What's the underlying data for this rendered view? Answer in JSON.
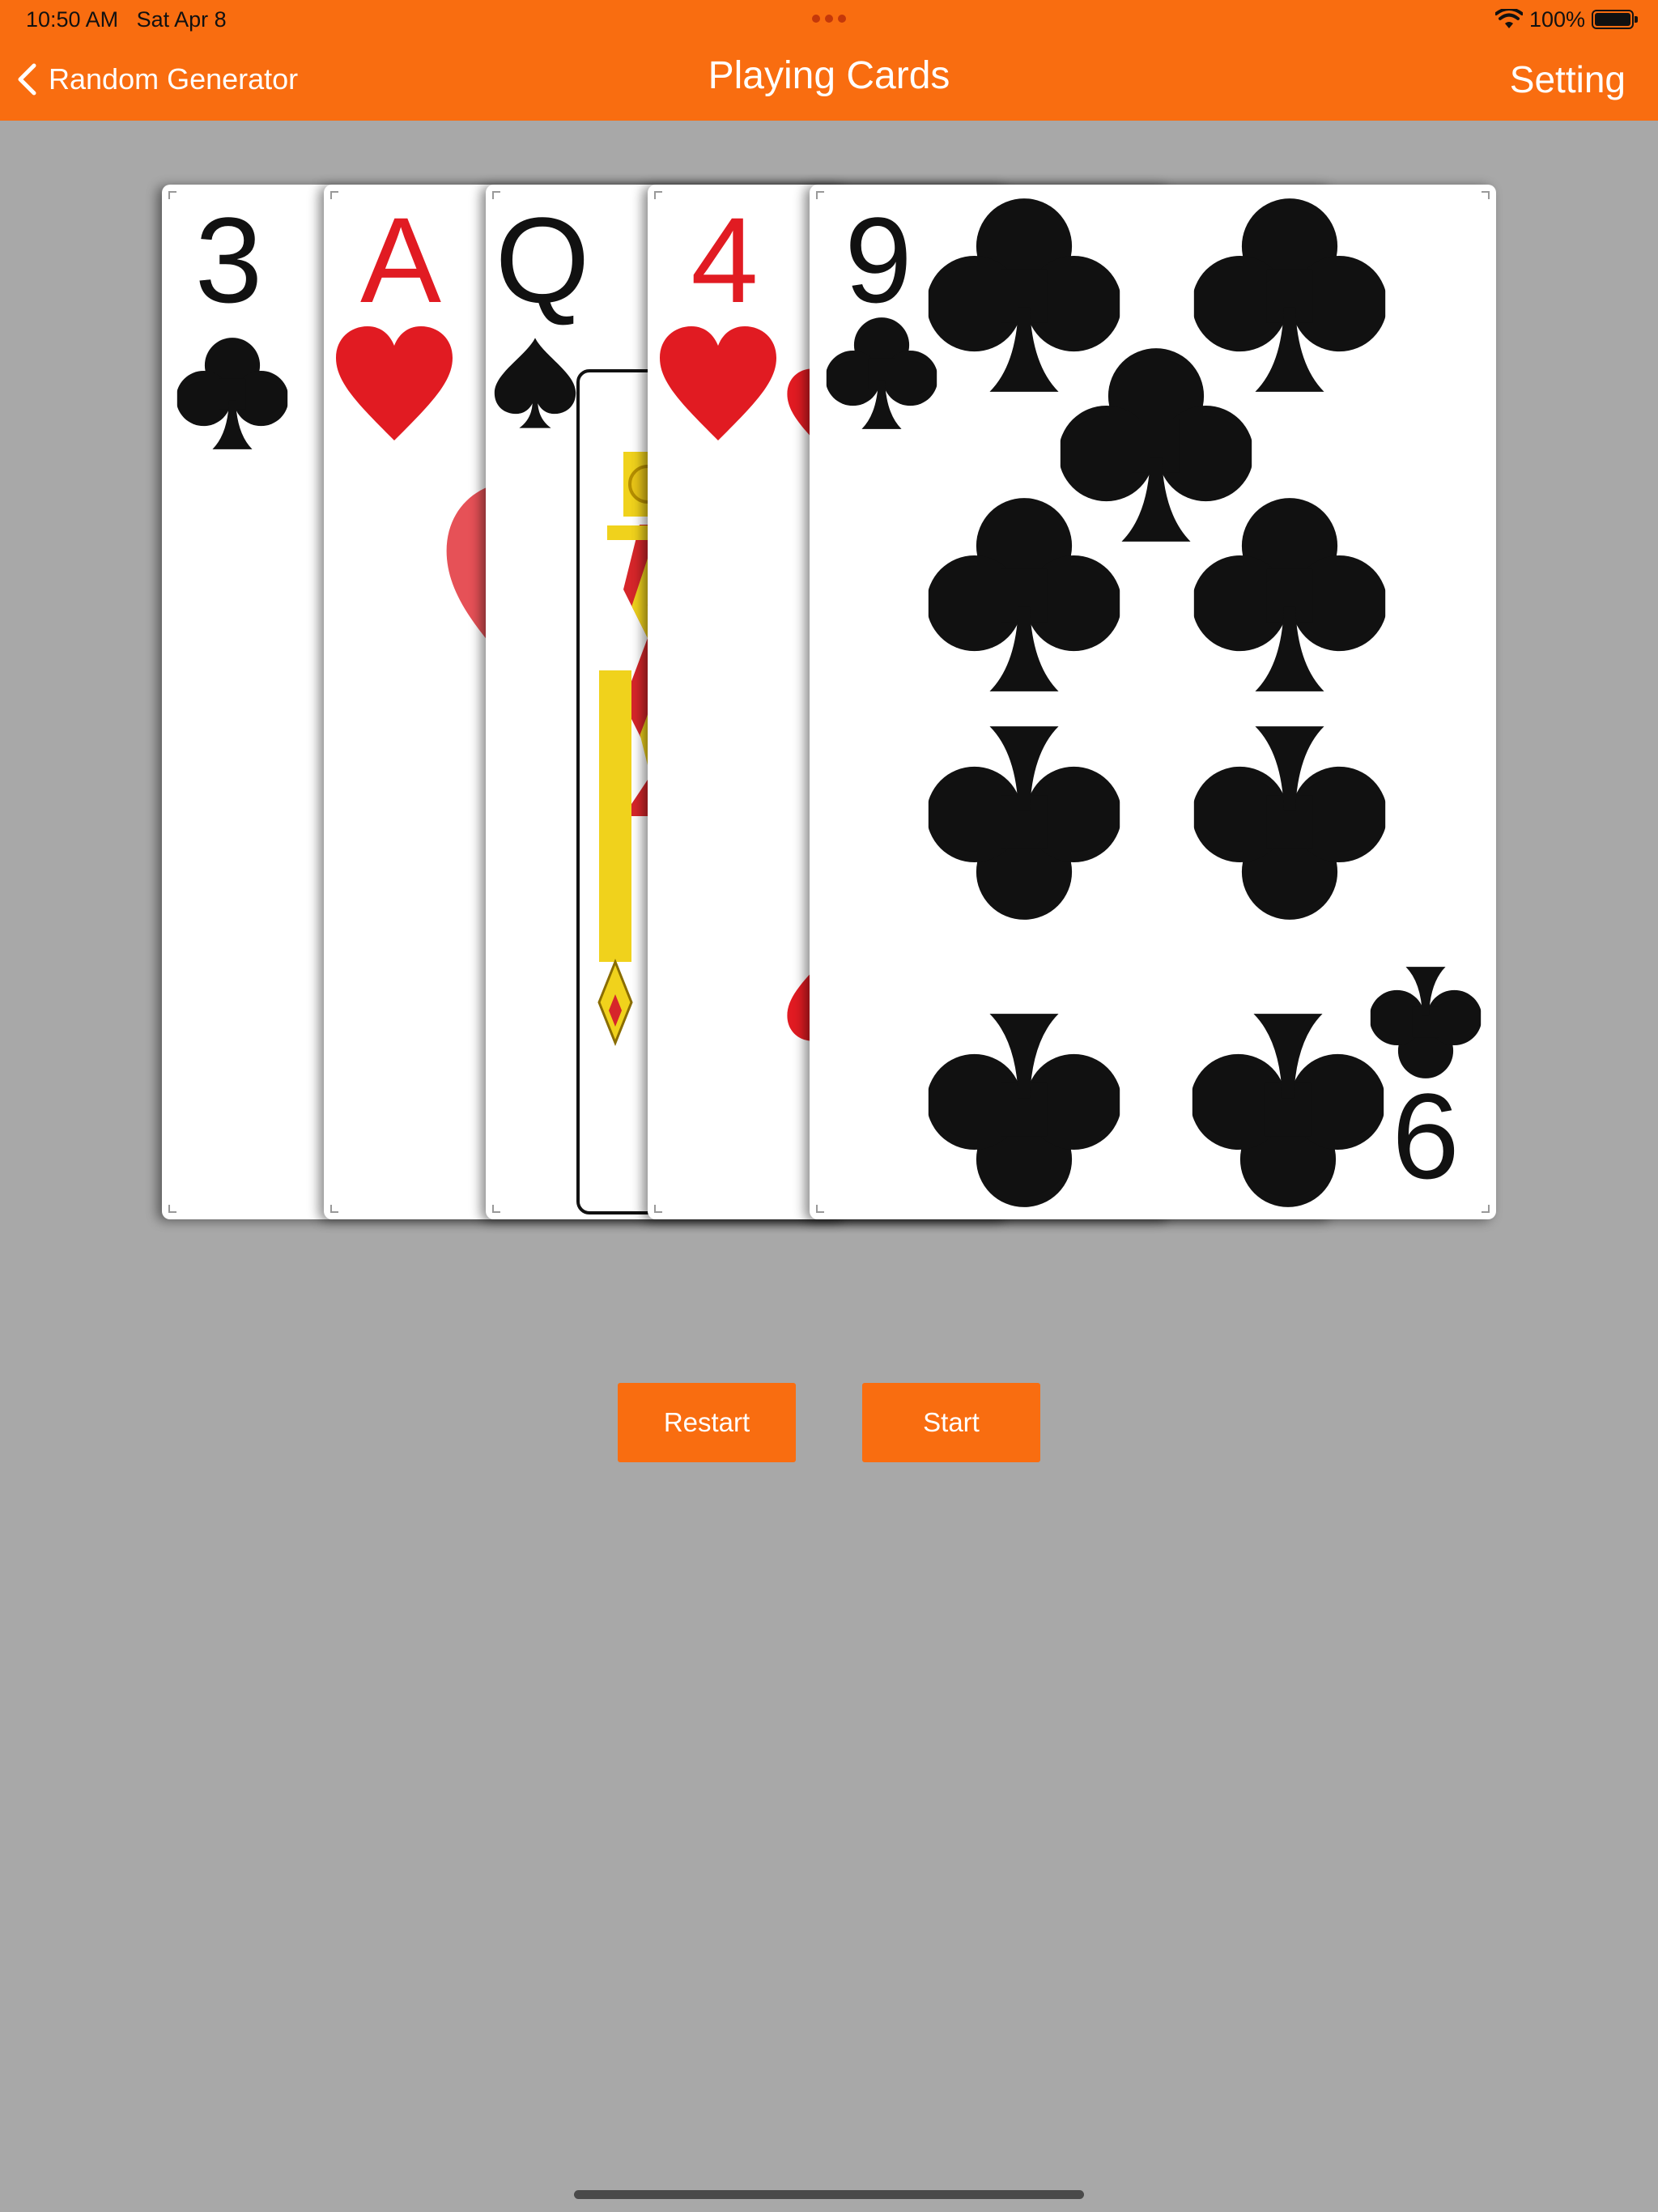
{
  "status_bar": {
    "time": "10:50 AM   Sat Apr 8",
    "battery": "100%"
  },
  "nav_bar": {
    "back_label": "Random Generator",
    "title": "Playing Cards",
    "right_label": "Setting"
  },
  "cards": [
    {
      "rank": "3",
      "suit": "clubs",
      "color": "black"
    },
    {
      "rank": "A",
      "suit": "hearts",
      "color": "red"
    },
    {
      "rank": "Q",
      "suit": "spades",
      "color": "black"
    },
    {
      "rank": "4",
      "suit": "hearts",
      "color": "red"
    },
    {
      "rank": "9",
      "suit": "clubs",
      "color": "black",
      "bottom_rank": "6"
    }
  ],
  "buttons": {
    "restart": "Restart",
    "start": "Start"
  },
  "colors": {
    "accent": "#f96d10",
    "background": "#a8a8a8",
    "red_suit": "#e11b22"
  }
}
